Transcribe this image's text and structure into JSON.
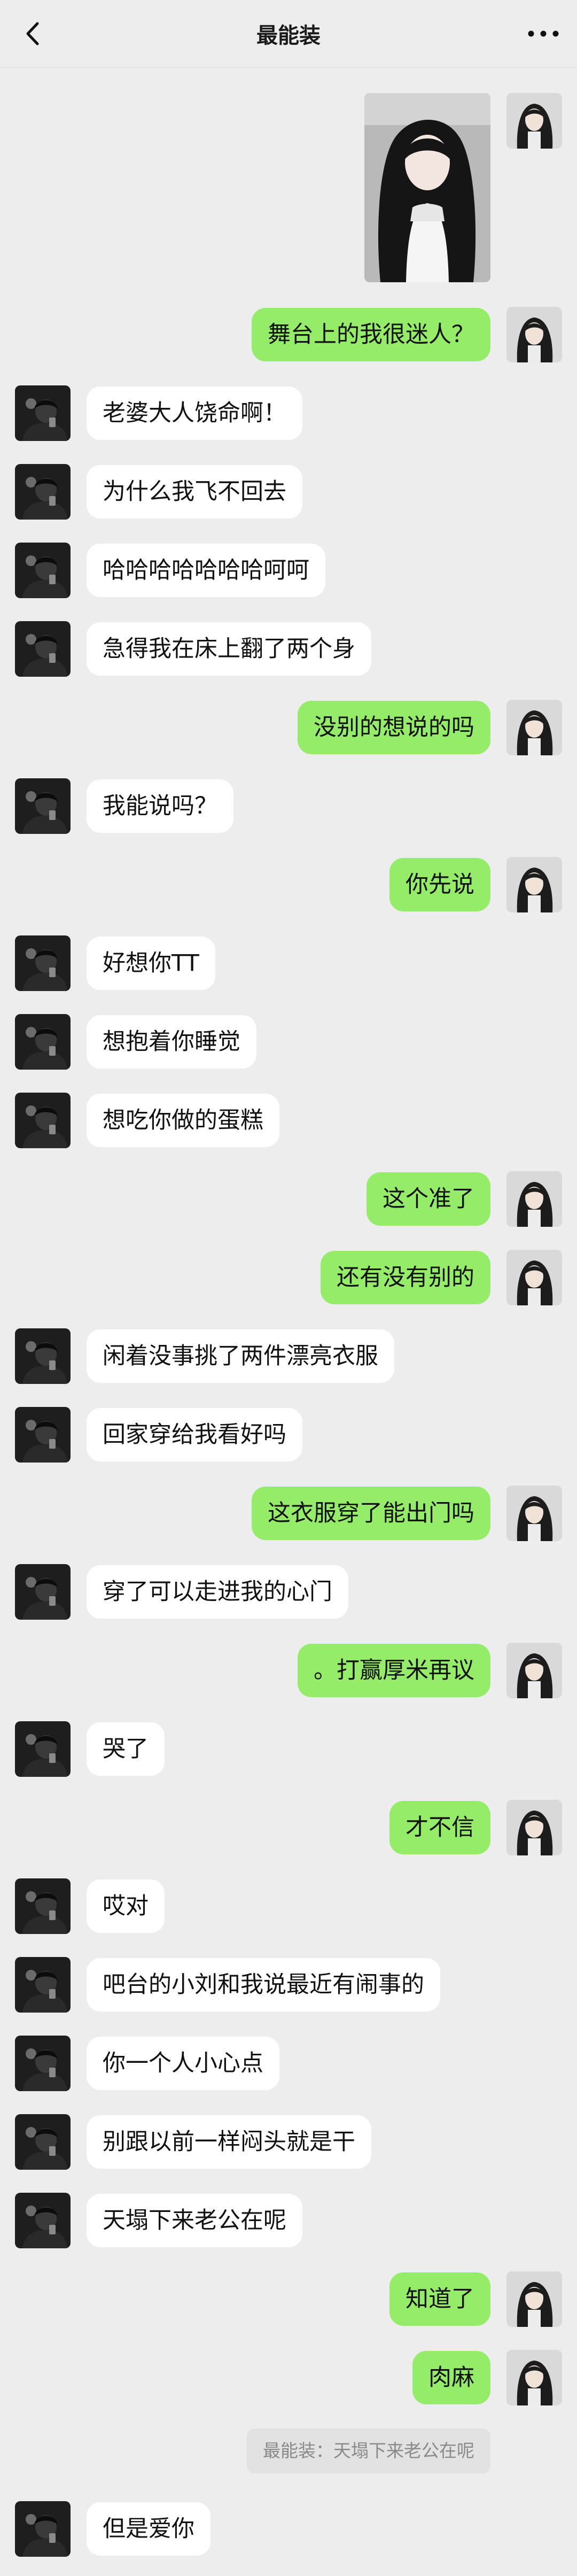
{
  "header": {
    "title": "最能装",
    "back_icon": "chevron-left-icon",
    "more_icon": "more-dots-icon"
  },
  "colors": {
    "background": "#ededed",
    "sent_bubble": "#95ec69",
    "received_bubble": "#ffffff"
  },
  "messages": [
    {
      "from": "me",
      "type": "image",
      "image": "photo-of-woman-with-long-dark-hair"
    },
    {
      "from": "me",
      "type": "text",
      "text": "舞台上的我很迷人？"
    },
    {
      "from": "them",
      "type": "text",
      "text": "老婆大人饶命啊！"
    },
    {
      "from": "them",
      "type": "text",
      "text": "为什么我飞不回去"
    },
    {
      "from": "them",
      "type": "text",
      "text": "哈哈哈哈哈哈哈呵呵"
    },
    {
      "from": "them",
      "type": "text",
      "text": "急得我在床上翻了两个身"
    },
    {
      "from": "me",
      "type": "text",
      "text": "没别的想说的吗"
    },
    {
      "from": "them",
      "type": "text",
      "text": "我能说吗？"
    },
    {
      "from": "me",
      "type": "text",
      "text": "你先说"
    },
    {
      "from": "them",
      "type": "text",
      "text": "好想你TT"
    },
    {
      "from": "them",
      "type": "text",
      "text": "想抱着你睡觉"
    },
    {
      "from": "them",
      "type": "text",
      "text": "想吃你做的蛋糕"
    },
    {
      "from": "me",
      "type": "text",
      "text": "这个准了"
    },
    {
      "from": "me",
      "type": "text",
      "text": "还有没有别的"
    },
    {
      "from": "them",
      "type": "text",
      "text": "闲着没事挑了两件漂亮衣服"
    },
    {
      "from": "them",
      "type": "text",
      "text": "回家穿给我看好吗"
    },
    {
      "from": "me",
      "type": "text",
      "text": "这衣服穿了能出门吗"
    },
    {
      "from": "them",
      "type": "text",
      "text": "穿了可以走进我的心门"
    },
    {
      "from": "me",
      "type": "text",
      "text": "。打赢厚米再议"
    },
    {
      "from": "them",
      "type": "text",
      "text": "哭了"
    },
    {
      "from": "me",
      "type": "text",
      "text": "才不信"
    },
    {
      "from": "them",
      "type": "text",
      "text": "哎对"
    },
    {
      "from": "them",
      "type": "text",
      "text": "吧台的小刘和我说最近有闹事的"
    },
    {
      "from": "them",
      "type": "text",
      "text": "你一个人小心点"
    },
    {
      "from": "them",
      "type": "text",
      "text": "别跟以前一样闷头就是干"
    },
    {
      "from": "them",
      "type": "text",
      "text": "天塌下来老公在呢"
    },
    {
      "from": "me",
      "type": "text",
      "text": "知道了"
    },
    {
      "from": "me",
      "type": "text",
      "text": "肉麻"
    },
    {
      "from": "me",
      "type": "quote",
      "text": "最能装：天塌下来老公在呢"
    },
    {
      "from": "them",
      "type": "text",
      "text": "但是爱你"
    }
  ]
}
